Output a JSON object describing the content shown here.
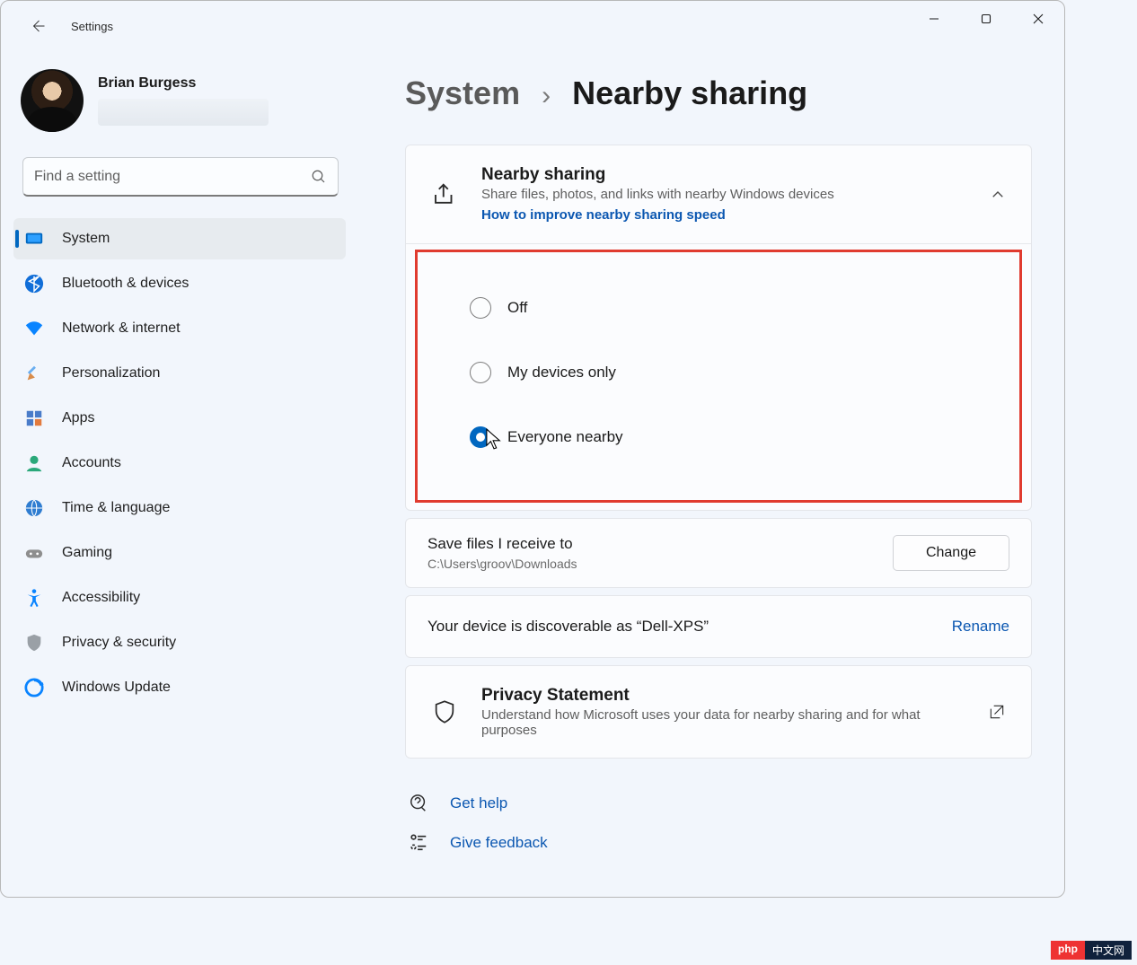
{
  "app_title": "Settings",
  "user": {
    "name": "Brian Burgess"
  },
  "search": {
    "placeholder": "Find a setting"
  },
  "sidebar": {
    "items": [
      {
        "label": "System"
      },
      {
        "label": "Bluetooth & devices"
      },
      {
        "label": "Network & internet"
      },
      {
        "label": "Personalization"
      },
      {
        "label": "Apps"
      },
      {
        "label": "Accounts"
      },
      {
        "label": "Time & language"
      },
      {
        "label": "Gaming"
      },
      {
        "label": "Accessibility"
      },
      {
        "label": "Privacy & security"
      },
      {
        "label": "Windows Update"
      }
    ],
    "selected_index": 0
  },
  "breadcrumb": {
    "parent": "System",
    "current": "Nearby sharing"
  },
  "sharing_card": {
    "title": "Nearby sharing",
    "desc": "Share files, photos, and links with nearby Windows devices",
    "link": "How to improve nearby sharing speed"
  },
  "radio_options": {
    "off": "Off",
    "mine": "My devices only",
    "everyone": "Everyone nearby",
    "selected": "everyone"
  },
  "save_files": {
    "title": "Save files I receive to",
    "path": "C:\\Users\\groov\\Downloads",
    "button": "Change"
  },
  "discoverable": {
    "text": "Your device is discoverable as “Dell-XPS”",
    "action": "Rename"
  },
  "privacy": {
    "title": "Privacy Statement",
    "desc": "Understand how Microsoft uses your data for nearby sharing and for what purposes"
  },
  "help": {
    "get_help": "Get help",
    "give_feedback": "Give feedback"
  },
  "watermark": {
    "a": "php",
    "b": "中文网"
  }
}
